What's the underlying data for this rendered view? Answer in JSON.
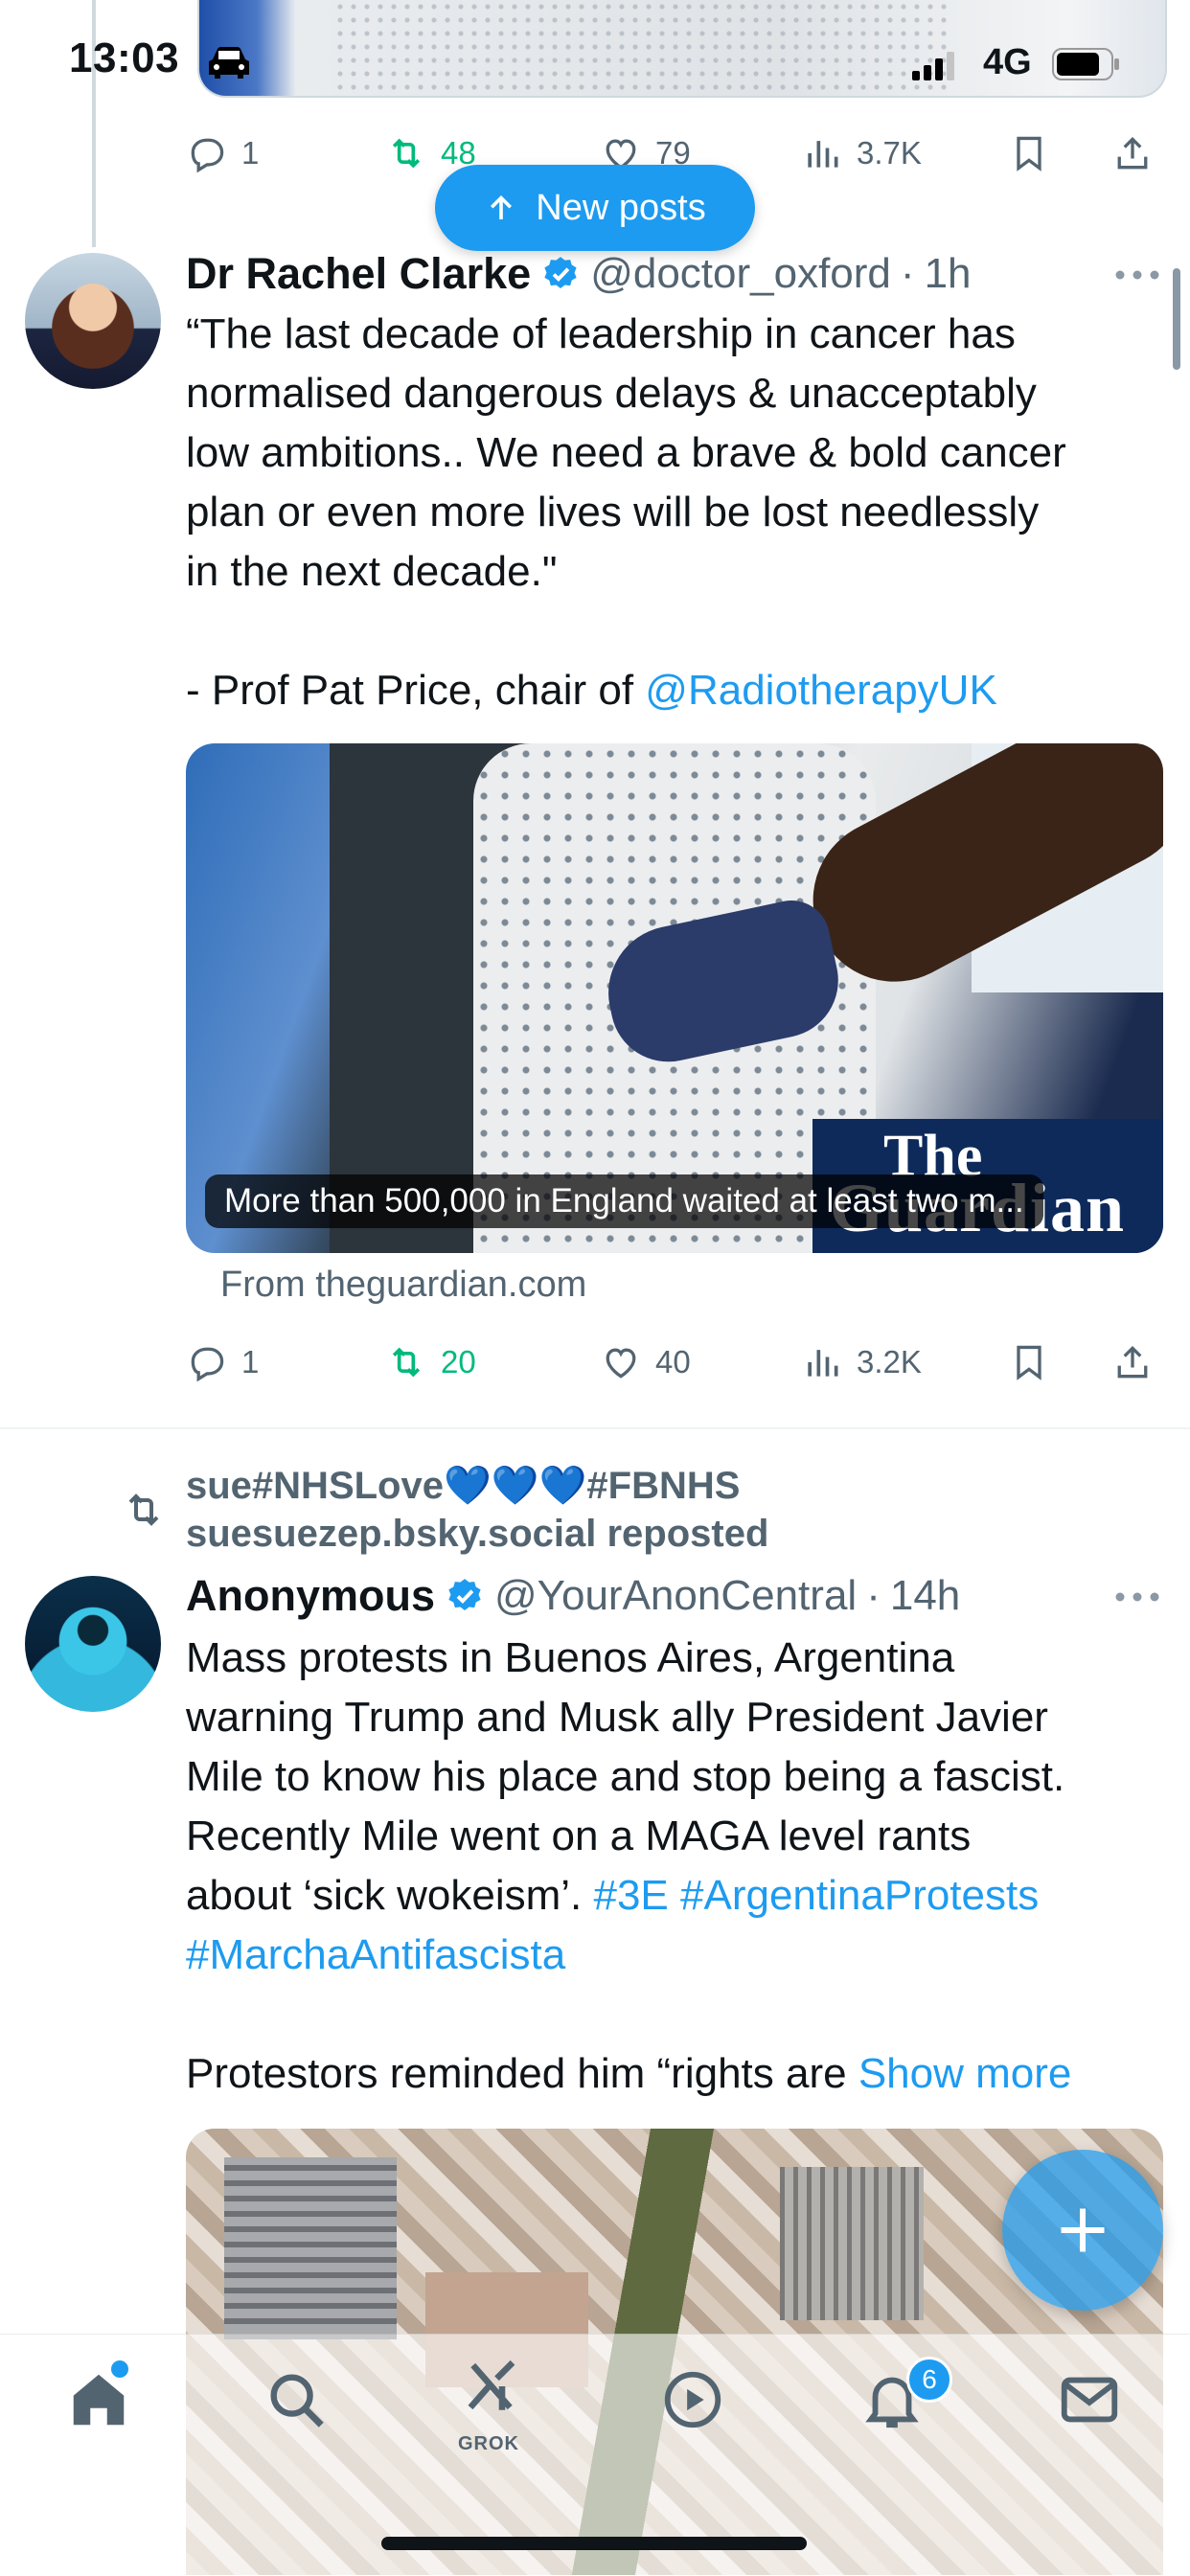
{
  "status_bar": {
    "time": "13:03",
    "network": "4G"
  },
  "new_posts_label": "New posts",
  "top_tweet": {
    "actions": {
      "replies": "1",
      "reposts": "48",
      "likes": "79",
      "views": "3.7K"
    }
  },
  "tweet1": {
    "name": "Dr Rachel Clarke",
    "handle": "@doctor_oxford",
    "time": "1h",
    "text_line1": "“The last decade of leadership in cancer has",
    "text_line2": "normalised dangerous delays & unacceptably",
    "text_line3": "low ambitions.. We need a brave & bold cancer",
    "text_line4": "plan or even more lives will be lost needlessly",
    "text_line5": "in the next decade.\"",
    "attribution_prefix": "- Prof Pat Price, chair of ",
    "mention": "@RadiotherapyUK",
    "card": {
      "caption": "More than 500,000 in England waited at least two m...",
      "logo_line1": "The",
      "logo_line2": "Guardian",
      "source": "From theguardian.com"
    },
    "actions": {
      "replies": "1",
      "reposts": "20",
      "likes": "40",
      "views": "3.2K"
    }
  },
  "tweet2": {
    "repost_by_line1": "sue#NHSLove💙💙💙#FBNHS",
    "repost_by_line2": "suesuezep.bsky.social reposted",
    "name": "Anonymous",
    "handle": "@YourAnonCentral",
    "time": "14h",
    "text_line1": "Mass protests in Buenos Aires, Argentina",
    "text_line2": "warning Trump and Musk ally President Javier",
    "text_line3": "Mile to know his place and stop being a fascist.",
    "text_line4": "Recently Mile went on a MAGA level rants",
    "text_line5_prefix": "about ‘sick wokeism’. ",
    "hashtag1": "#3E",
    "hashtag2": "#ArgentinaProtests",
    "hashtag3": "#MarchaAntifascista",
    "text_line7": "Protestors reminded him “rights are ",
    "show_more": "Show more"
  },
  "bottom_nav": {
    "grok_label": "GROK",
    "notifications_count": "6"
  },
  "colors": {
    "accent": "#1d9bf0",
    "repost_green": "#00ba7c",
    "secondary_text": "#536471"
  }
}
